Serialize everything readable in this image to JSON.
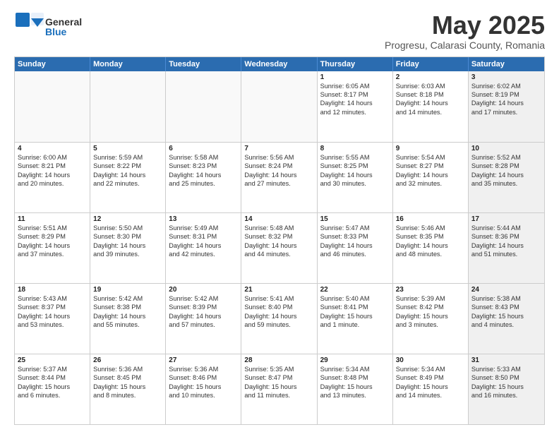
{
  "logo": {
    "general": "General",
    "blue": "Blue"
  },
  "title": "May 2025",
  "location": "Progresu, Calarasi County, Romania",
  "weekdays": [
    "Sunday",
    "Monday",
    "Tuesday",
    "Wednesday",
    "Thursday",
    "Friday",
    "Saturday"
  ],
  "weeks": [
    [
      {
        "day": "",
        "text": "",
        "empty": true
      },
      {
        "day": "",
        "text": "",
        "empty": true
      },
      {
        "day": "",
        "text": "",
        "empty": true
      },
      {
        "day": "",
        "text": "",
        "empty": true
      },
      {
        "day": "1",
        "text": "Sunrise: 6:05 AM\nSunset: 8:17 PM\nDaylight: 14 hours\nand 12 minutes."
      },
      {
        "day": "2",
        "text": "Sunrise: 6:03 AM\nSunset: 8:18 PM\nDaylight: 14 hours\nand 14 minutes."
      },
      {
        "day": "3",
        "text": "Sunrise: 6:02 AM\nSunset: 8:19 PM\nDaylight: 14 hours\nand 17 minutes.",
        "shaded": true
      }
    ],
    [
      {
        "day": "4",
        "text": "Sunrise: 6:00 AM\nSunset: 8:21 PM\nDaylight: 14 hours\nand 20 minutes."
      },
      {
        "day": "5",
        "text": "Sunrise: 5:59 AM\nSunset: 8:22 PM\nDaylight: 14 hours\nand 22 minutes."
      },
      {
        "day": "6",
        "text": "Sunrise: 5:58 AM\nSunset: 8:23 PM\nDaylight: 14 hours\nand 25 minutes."
      },
      {
        "day": "7",
        "text": "Sunrise: 5:56 AM\nSunset: 8:24 PM\nDaylight: 14 hours\nand 27 minutes."
      },
      {
        "day": "8",
        "text": "Sunrise: 5:55 AM\nSunset: 8:25 PM\nDaylight: 14 hours\nand 30 minutes."
      },
      {
        "day": "9",
        "text": "Sunrise: 5:54 AM\nSunset: 8:27 PM\nDaylight: 14 hours\nand 32 minutes."
      },
      {
        "day": "10",
        "text": "Sunrise: 5:52 AM\nSunset: 8:28 PM\nDaylight: 14 hours\nand 35 minutes.",
        "shaded": true
      }
    ],
    [
      {
        "day": "11",
        "text": "Sunrise: 5:51 AM\nSunset: 8:29 PM\nDaylight: 14 hours\nand 37 minutes."
      },
      {
        "day": "12",
        "text": "Sunrise: 5:50 AM\nSunset: 8:30 PM\nDaylight: 14 hours\nand 39 minutes."
      },
      {
        "day": "13",
        "text": "Sunrise: 5:49 AM\nSunset: 8:31 PM\nDaylight: 14 hours\nand 42 minutes."
      },
      {
        "day": "14",
        "text": "Sunrise: 5:48 AM\nSunset: 8:32 PM\nDaylight: 14 hours\nand 44 minutes."
      },
      {
        "day": "15",
        "text": "Sunrise: 5:47 AM\nSunset: 8:33 PM\nDaylight: 14 hours\nand 46 minutes."
      },
      {
        "day": "16",
        "text": "Sunrise: 5:46 AM\nSunset: 8:35 PM\nDaylight: 14 hours\nand 48 minutes."
      },
      {
        "day": "17",
        "text": "Sunrise: 5:44 AM\nSunset: 8:36 PM\nDaylight: 14 hours\nand 51 minutes.",
        "shaded": true
      }
    ],
    [
      {
        "day": "18",
        "text": "Sunrise: 5:43 AM\nSunset: 8:37 PM\nDaylight: 14 hours\nand 53 minutes."
      },
      {
        "day": "19",
        "text": "Sunrise: 5:42 AM\nSunset: 8:38 PM\nDaylight: 14 hours\nand 55 minutes."
      },
      {
        "day": "20",
        "text": "Sunrise: 5:42 AM\nSunset: 8:39 PM\nDaylight: 14 hours\nand 57 minutes."
      },
      {
        "day": "21",
        "text": "Sunrise: 5:41 AM\nSunset: 8:40 PM\nDaylight: 14 hours\nand 59 minutes."
      },
      {
        "day": "22",
        "text": "Sunrise: 5:40 AM\nSunset: 8:41 PM\nDaylight: 15 hours\nand 1 minute."
      },
      {
        "day": "23",
        "text": "Sunrise: 5:39 AM\nSunset: 8:42 PM\nDaylight: 15 hours\nand 3 minutes."
      },
      {
        "day": "24",
        "text": "Sunrise: 5:38 AM\nSunset: 8:43 PM\nDaylight: 15 hours\nand 4 minutes.",
        "shaded": true
      }
    ],
    [
      {
        "day": "25",
        "text": "Sunrise: 5:37 AM\nSunset: 8:44 PM\nDaylight: 15 hours\nand 6 minutes."
      },
      {
        "day": "26",
        "text": "Sunrise: 5:36 AM\nSunset: 8:45 PM\nDaylight: 15 hours\nand 8 minutes."
      },
      {
        "day": "27",
        "text": "Sunrise: 5:36 AM\nSunset: 8:46 PM\nDaylight: 15 hours\nand 10 minutes."
      },
      {
        "day": "28",
        "text": "Sunrise: 5:35 AM\nSunset: 8:47 PM\nDaylight: 15 hours\nand 11 minutes."
      },
      {
        "day": "29",
        "text": "Sunrise: 5:34 AM\nSunset: 8:48 PM\nDaylight: 15 hours\nand 13 minutes."
      },
      {
        "day": "30",
        "text": "Sunrise: 5:34 AM\nSunset: 8:49 PM\nDaylight: 15 hours\nand 14 minutes."
      },
      {
        "day": "31",
        "text": "Sunrise: 5:33 AM\nSunset: 8:50 PM\nDaylight: 15 hours\nand 16 minutes.",
        "shaded": true
      }
    ]
  ]
}
